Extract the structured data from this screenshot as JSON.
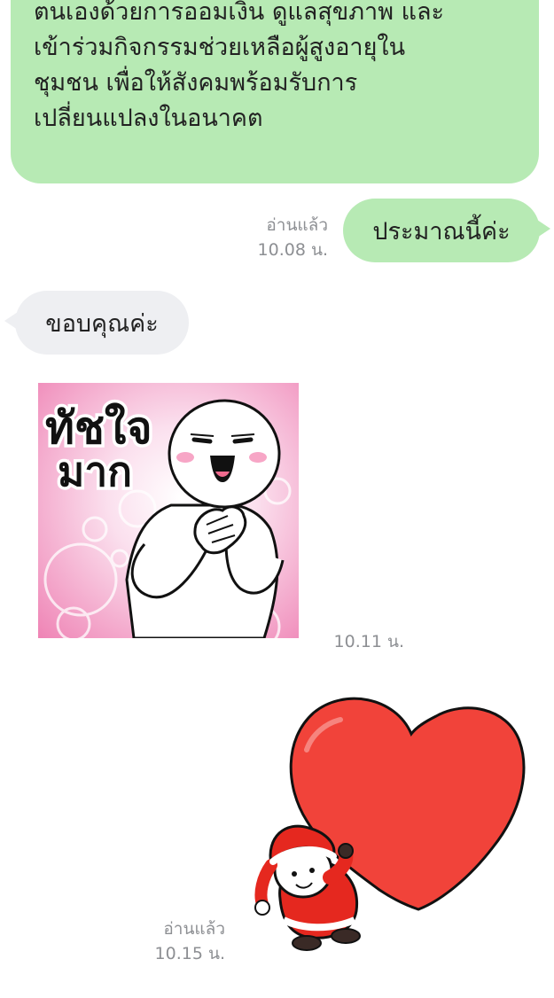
{
  "messages": {
    "m1": {
      "text": "ตนเองด้วยการออมเงิน ดูแลสุขภาพ และ\nเข้าร่วมกิจกรรมช่วยเหลือผู้สูงอายุใน\nชุมชน เพื่อให้สังคมพร้อมรับการ\nเปลี่ยนแปลงในอนาคต"
    },
    "m2": {
      "text": "ประมาณนี้ค่ะ",
      "read": "อ่านแล้ว",
      "time": "10.08 น."
    },
    "m3": {
      "text": "ขอบคุณค่ะ"
    },
    "m4": {
      "sticker_text": "ทัชใจมาก",
      "time": "10.11 น."
    },
    "m5": {
      "read": "อ่านแล้ว",
      "time": "10.15 น."
    }
  },
  "colors": {
    "outgoing_bubble": "#b7eab4",
    "incoming_bubble": "#eeeff2",
    "meta_text": "#8d8f93",
    "heart": "#f1433a",
    "santa": "#e5281f"
  },
  "icons": {
    "sticker_1": "character-hands-on-heart-sticker",
    "sticker_2": "santa-carrying-heart-sticker"
  }
}
